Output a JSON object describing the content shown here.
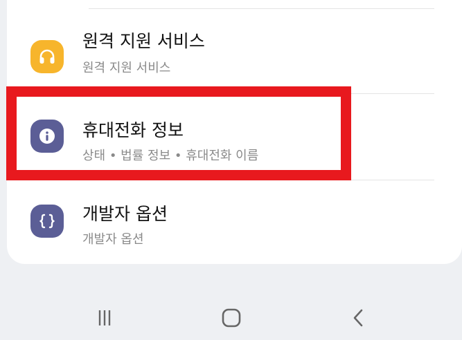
{
  "items": [
    {
      "title": "원격 지원 서비스",
      "subtitle": "원격 지원 서비스",
      "icon": "headset-icon",
      "color": "#f7b52c"
    },
    {
      "title": "휴대전화 정보",
      "subtitle": "상태 • 법률 정보 • 휴대전화 이름",
      "icon": "info-icon",
      "color": "#5b5e96"
    },
    {
      "title": "개발자 옵션",
      "subtitle": "개발자 옵션",
      "icon": "braces-icon",
      "color": "#5b5e96"
    }
  ],
  "highlight_color": "#e8191e",
  "navbar": {
    "buttons": [
      "recent-apps-icon",
      "home-icon",
      "back-icon"
    ]
  }
}
